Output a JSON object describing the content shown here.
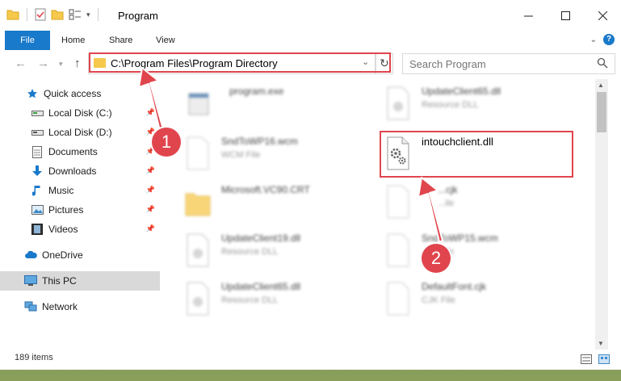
{
  "window": {
    "title": "Program"
  },
  "ribbon": {
    "tabs": [
      "File",
      "Home",
      "Share",
      "View"
    ],
    "help_label": "?"
  },
  "navbar": {
    "address": "C:\\Program Files\\Program Directory",
    "search_placeholder": "Search Program"
  },
  "sidebar": {
    "items": [
      {
        "label": "Quick access",
        "icon": "star-icon",
        "pinned": false
      },
      {
        "label": "Local Disk (C:)",
        "icon": "drive-icon",
        "pinned": true
      },
      {
        "label": "Local Disk (D:)",
        "icon": "drive-icon",
        "pinned": true
      },
      {
        "label": "Documents",
        "icon": "document-icon",
        "pinned": true
      },
      {
        "label": "Downloads",
        "icon": "download-icon",
        "pinned": true
      },
      {
        "label": "Music",
        "icon": "music-icon",
        "pinned": true
      },
      {
        "label": "Pictures",
        "icon": "pictures-icon",
        "pinned": true
      },
      {
        "label": "Videos",
        "icon": "videos-icon",
        "pinned": true
      },
      {
        "label": "OneDrive",
        "icon": "cloud-icon",
        "pinned": false
      },
      {
        "label": "This PC",
        "icon": "computer-icon",
        "pinned": false,
        "selected": true
      },
      {
        "label": "Network",
        "icon": "network-icon",
        "pinned": false
      }
    ]
  },
  "files": [
    {
      "name": "program.exe",
      "type": ""
    },
    {
      "name": "UpdateClient65.dll",
      "type": "Resource DLL"
    },
    {
      "name": "SndToWP16.wcm",
      "type": "WCM File"
    },
    {
      "name": "intouchclient.dll",
      "type": ""
    },
    {
      "name": "Microsoft.VC90.CRT",
      "type": ""
    },
    {
      "name": "...cjk",
      "type": "...ile"
    },
    {
      "name": "UpdateClient19.dll",
      "type": "Resource DLL"
    },
    {
      "name": "SndToWP15.wcm",
      "type": "...ile"
    },
    {
      "name": "UpdateClient65.dll",
      "type": "Resource DLL"
    },
    {
      "name": "DefaultFont.cjk",
      "type": "CJK File"
    }
  ],
  "status": {
    "item_count": "189 items"
  },
  "callouts": [
    "1",
    "2"
  ],
  "colors": {
    "accent": "#1979ca",
    "highlight": "#e0454d",
    "folder": "#f6c94c"
  }
}
